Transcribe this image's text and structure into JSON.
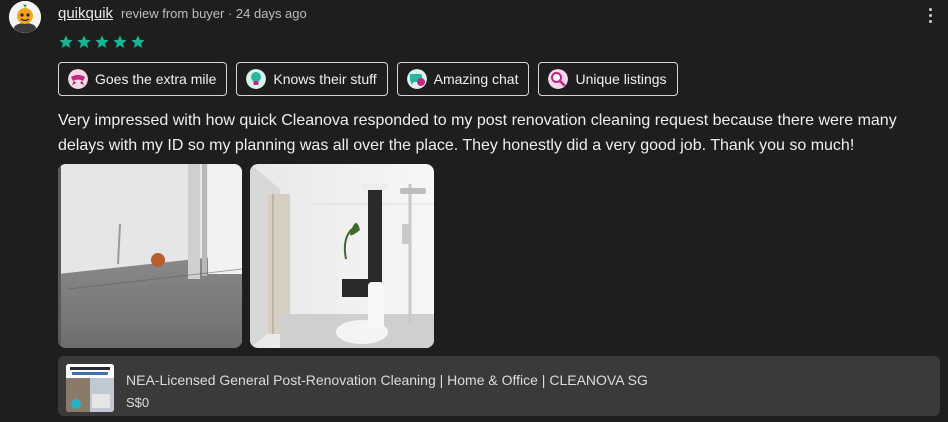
{
  "reviewer": {
    "username": "quikquik",
    "meta": "review from buyer · 24 days ago",
    "rating": 5
  },
  "colors": {
    "star": "#1ab394",
    "background": "#1e1e1e",
    "listing_bg": "#3a3a3a"
  },
  "tags": [
    {
      "label": "Goes the extra mile",
      "icon": "ribbon-icon"
    },
    {
      "label": "Knows their stuff",
      "icon": "lightbulb-icon"
    },
    {
      "label": "Amazing chat",
      "icon": "chat-bubble-icon"
    },
    {
      "label": "Unique listings",
      "icon": "magnifier-icon"
    }
  ],
  "review_text": "Very impressed with how quick Cleanova responded to my post renovation cleaning request because there were many delays with my ID so my planning was all over the place. They honestly did a very good job. Thank you so much!",
  "photos": [
    {
      "description_icon": "bathroom-before-photo"
    },
    {
      "description_icon": "bathroom-after-photo"
    }
  ],
  "listing": {
    "title": "NEA-Licensed General Post-Renovation Cleaning | Home & Office | CLEANOVA SG",
    "price": "S$0"
  }
}
